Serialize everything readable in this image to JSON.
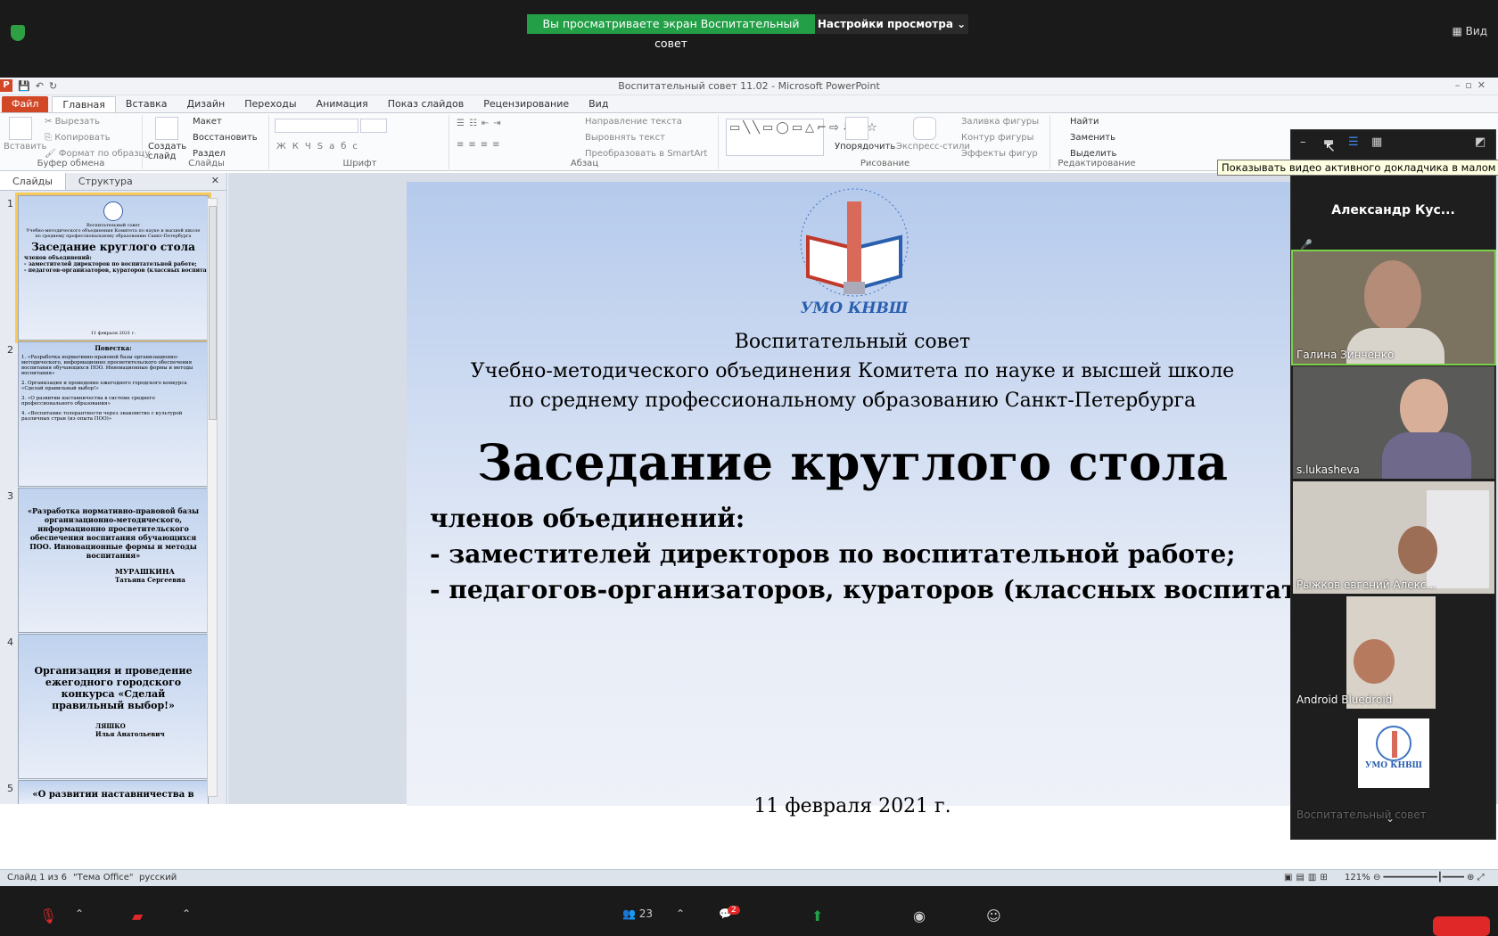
{
  "zoom": {
    "share_banner": "Вы просматриваете экран Воспитательный совет",
    "view_options": "Настройки просмотра ⌄",
    "view_button": "Вид",
    "participants_count": "23",
    "chat_badge": "2"
  },
  "ppt": {
    "window_title": "Воспитательный совет 11.02  -  Microsoft PowerPoint",
    "menu": [
      "Файл",
      "Главная",
      "Вставка",
      "Дизайн",
      "Переходы",
      "Анимация",
      "Показ слайдов",
      "Рецензирование",
      "Вид"
    ],
    "ribbon": {
      "clipboard": {
        "paste": "Вставить",
        "cut": "Вырезать",
        "copy": "Копировать",
        "format": "Формат по образцу",
        "name": "Буфер обмена"
      },
      "slides": {
        "new": "Создать слайд",
        "layout": "Макет",
        "reset": "Восстановить",
        "section": "Раздел",
        "name": "Слайды"
      },
      "font": {
        "name": "Шрифт"
      },
      "paragraph": {
        "text_dir": "Направление текста",
        "align": "Выровнять текст",
        "smartart": "Преобразовать в SmartArt",
        "name": "Абзац"
      },
      "drawing": {
        "arrange": "Упорядочить",
        "quick_styles": "Экспресс-стили",
        "fill": "Заливка фигуры",
        "outline": "Контур фигуры",
        "effects": "Эффекты фигур",
        "name": "Рисование"
      },
      "editing": {
        "find": "Найти",
        "replace": "Заменить",
        "select": "Выделить",
        "name": "Редактирование"
      }
    },
    "pane_tabs": [
      "Слайды",
      "Структура"
    ],
    "thumbs": [
      {
        "num": "1",
        "org": "Воспитательный совет",
        "org2": "Учебно-методического объединения Комитета по науке и высшей школе",
        "org3": "по среднему профессиональному образованию Санкт-Петербурга",
        "title": "Заседание круглого стола",
        "b1": "членов объединений:",
        "b2": "- заместителей директоров по воспитательной работе;",
        "b3": "- педагогов-организаторов, кураторов (классных воспитателей);",
        "date": "11 февраля 2021 г."
      },
      {
        "num": "2",
        "title": "Повестка:",
        "i1": "1. «Разработка нормативно-правовой базы организационно-методического, информационно просветительского обеспечения воспитания обучающихся ПОО. Инновационные формы и методы воспитания»",
        "i2": "2. Организация и проведение ежегодного городского конкурса «Сделай правильный выбор!»",
        "i3": "3. «О развитии наставничества в системе среднего профессионального образования»",
        "i4": "4. «Воспитание толерантности через знакомство с культурой различных стран (из опыта ПОО)»"
      },
      {
        "num": "3",
        "title": "«Разработка нормативно-правовой базы организационно-методического, информационно просветительского обеспечения воспитания обучающихся ПОО. Инновационные формы и методы воспитания»",
        "speaker": "МУРАШКИНА",
        "speaker2": "Татьяна Сергеевна"
      },
      {
        "num": "4",
        "title": "Организация и проведение ежегодного городского конкурса «Сделай правильный выбор!»",
        "speaker": "ЛЯШКО",
        "speaker2": "Илья Анатольевич"
      },
      {
        "num": "5",
        "title": "«О развитии наставничества в"
      }
    ],
    "slide": {
      "emblem_text": "УМО КНВШ",
      "org1": "Воспитательный совет",
      "org2": "Учебно-методического объединения Комитета по науке и высшей школе",
      "org3": "по среднему профессиональному образованию Санкт-Петербурга",
      "title": "Заседание круглого стола",
      "b1": "членов объединений:",
      "b2": "- заместителей директоров по воспитательной работе;",
      "b3": "- педагогов-организаторов, кураторов (классных воспитателей);",
      "date": "11 февраля 2021 г."
    },
    "status": {
      "slide": "Слайд 1 из 6",
      "theme": "\"Тема Office\"",
      "lang": "русский",
      "zoom": "121%"
    }
  },
  "gallery": {
    "tooltip": "Показывать видео активного докладчика в малом окне",
    "active_speaker": "Александр  Кус...",
    "tiles": [
      {
        "name": "Галина Зинченко"
      },
      {
        "name": "s.lukasheva"
      },
      {
        "name": "Рыжков евгений Алекс..."
      },
      {
        "name": "Android Bluedroid"
      },
      {
        "name": "Воспитательный совет"
      }
    ],
    "tile_logo_text": "УМО КНВШ"
  },
  "colors": {
    "accent_green": "#23a047",
    "ppt_orange": "#d24726",
    "active_border": "#7bd14b"
  }
}
